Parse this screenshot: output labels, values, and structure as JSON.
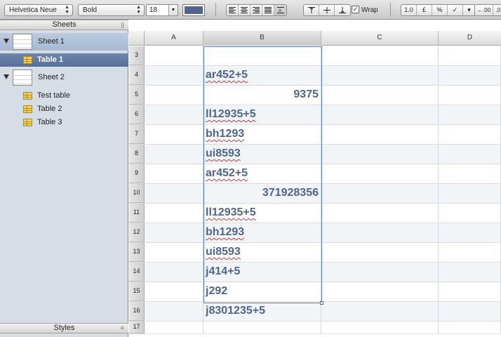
{
  "format_bar": {
    "font_family": "Helvetica Neue",
    "font_style": "Bold",
    "font_size": "18",
    "text_color": "#4f648f",
    "align_left": "≡",
    "align_center": "≡",
    "align_right": "≡",
    "align_justify": "≡",
    "align_auto": "A≡",
    "valign_top": "⊤",
    "valign_middle": "+",
    "valign_bottom": "⊥",
    "wrap_checked": "✓",
    "wrap_label": "Wrap",
    "fmt_decimal": "1.0",
    "fmt_currency": "£",
    "fmt_percent": "%",
    "fmt_checkbox": "✓",
    "fmt_menu": "▾",
    "fmt_more_decimals": "←.00",
    "fmt_fewer_decimals": ".0"
  },
  "sidebar": {
    "sheets_header": "Sheets",
    "styles_header": "Styles",
    "sheets": [
      {
        "label": "Sheet 1",
        "tables": [
          {
            "label": "Table 1",
            "selected": true
          }
        ]
      },
      {
        "label": "Sheet 2",
        "tables": [
          {
            "label": "Test table"
          },
          {
            "label": "Table 2"
          },
          {
            "label": "Table 3"
          }
        ]
      }
    ]
  },
  "grid": {
    "columns": [
      "A",
      "B",
      "C",
      "D"
    ],
    "active_column": "B",
    "rows": [
      {
        "num": "3",
        "b": ""
      },
      {
        "num": "4",
        "b": "ar452+5",
        "spell": true
      },
      {
        "num": "5",
        "b": "9375",
        "numeric": true
      },
      {
        "num": "6",
        "b": "ll12935+5",
        "spell": true
      },
      {
        "num": "7",
        "b": "bh1293",
        "spell": true
      },
      {
        "num": "8",
        "b": "ui8593",
        "spell": true
      },
      {
        "num": "9",
        "b": "ar452+5",
        "spell": true
      },
      {
        "num": "10",
        "b": "371928356",
        "numeric": true
      },
      {
        "num": "11",
        "b": "ll12935+5",
        "spell": true
      },
      {
        "num": "12",
        "b": "bh1293",
        "spell": true
      },
      {
        "num": "13",
        "b": "ui8593",
        "spell": true
      },
      {
        "num": "14",
        "b": "j414+5"
      },
      {
        "num": "15",
        "b": "j292"
      },
      {
        "num": "16",
        "b": "j8301235+5"
      },
      {
        "num": "17",
        "b": ""
      }
    ]
  }
}
